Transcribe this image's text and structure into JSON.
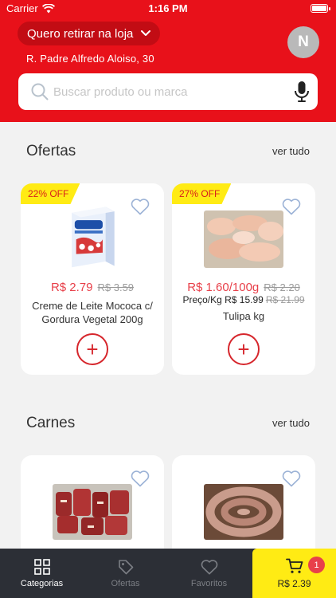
{
  "status_bar": {
    "carrier": "Carrier",
    "time": "1:16 PM"
  },
  "header": {
    "pickup_label": "Quero retirar na loja",
    "address": "R. Padre Alfredo Aloiso, 30",
    "avatar_initial": "N"
  },
  "search": {
    "placeholder": "Buscar produto ou marca"
  },
  "sections": [
    {
      "title": "Ofertas",
      "see_all": "ver tudo",
      "products": [
        {
          "badge": "22% OFF",
          "price": "R$ 2.79",
          "old_price": "R$ 3.59",
          "name": "Creme de Leite Mococa c/ Gordura Vegetal  200g",
          "add": "+"
        },
        {
          "badge": "27% OFF",
          "price": "R$ 1.60/100g",
          "old_price": "R$ 2.20",
          "per_kg_label": "Preço/Kg R$ 15.99",
          "per_kg_old": "R$ 21.99",
          "name": "Tulipa kg",
          "add": "+"
        }
      ]
    },
    {
      "title": "Carnes",
      "see_all": "ver tudo",
      "products": [
        {},
        {}
      ]
    }
  ],
  "bottom_nav": {
    "items": [
      {
        "label": "Categorias",
        "icon": "grid-icon",
        "active": true
      },
      {
        "label": "Ofertas",
        "icon": "tag-icon",
        "active": false
      },
      {
        "label": "Favoritos",
        "icon": "heart-icon",
        "active": false
      }
    ],
    "cart": {
      "total": "R$ 2.39",
      "count": "1"
    }
  },
  "colors": {
    "brand_red": "#e8111a",
    "offer_yellow": "#ffeb14",
    "nav_dark": "#2c2f36"
  }
}
